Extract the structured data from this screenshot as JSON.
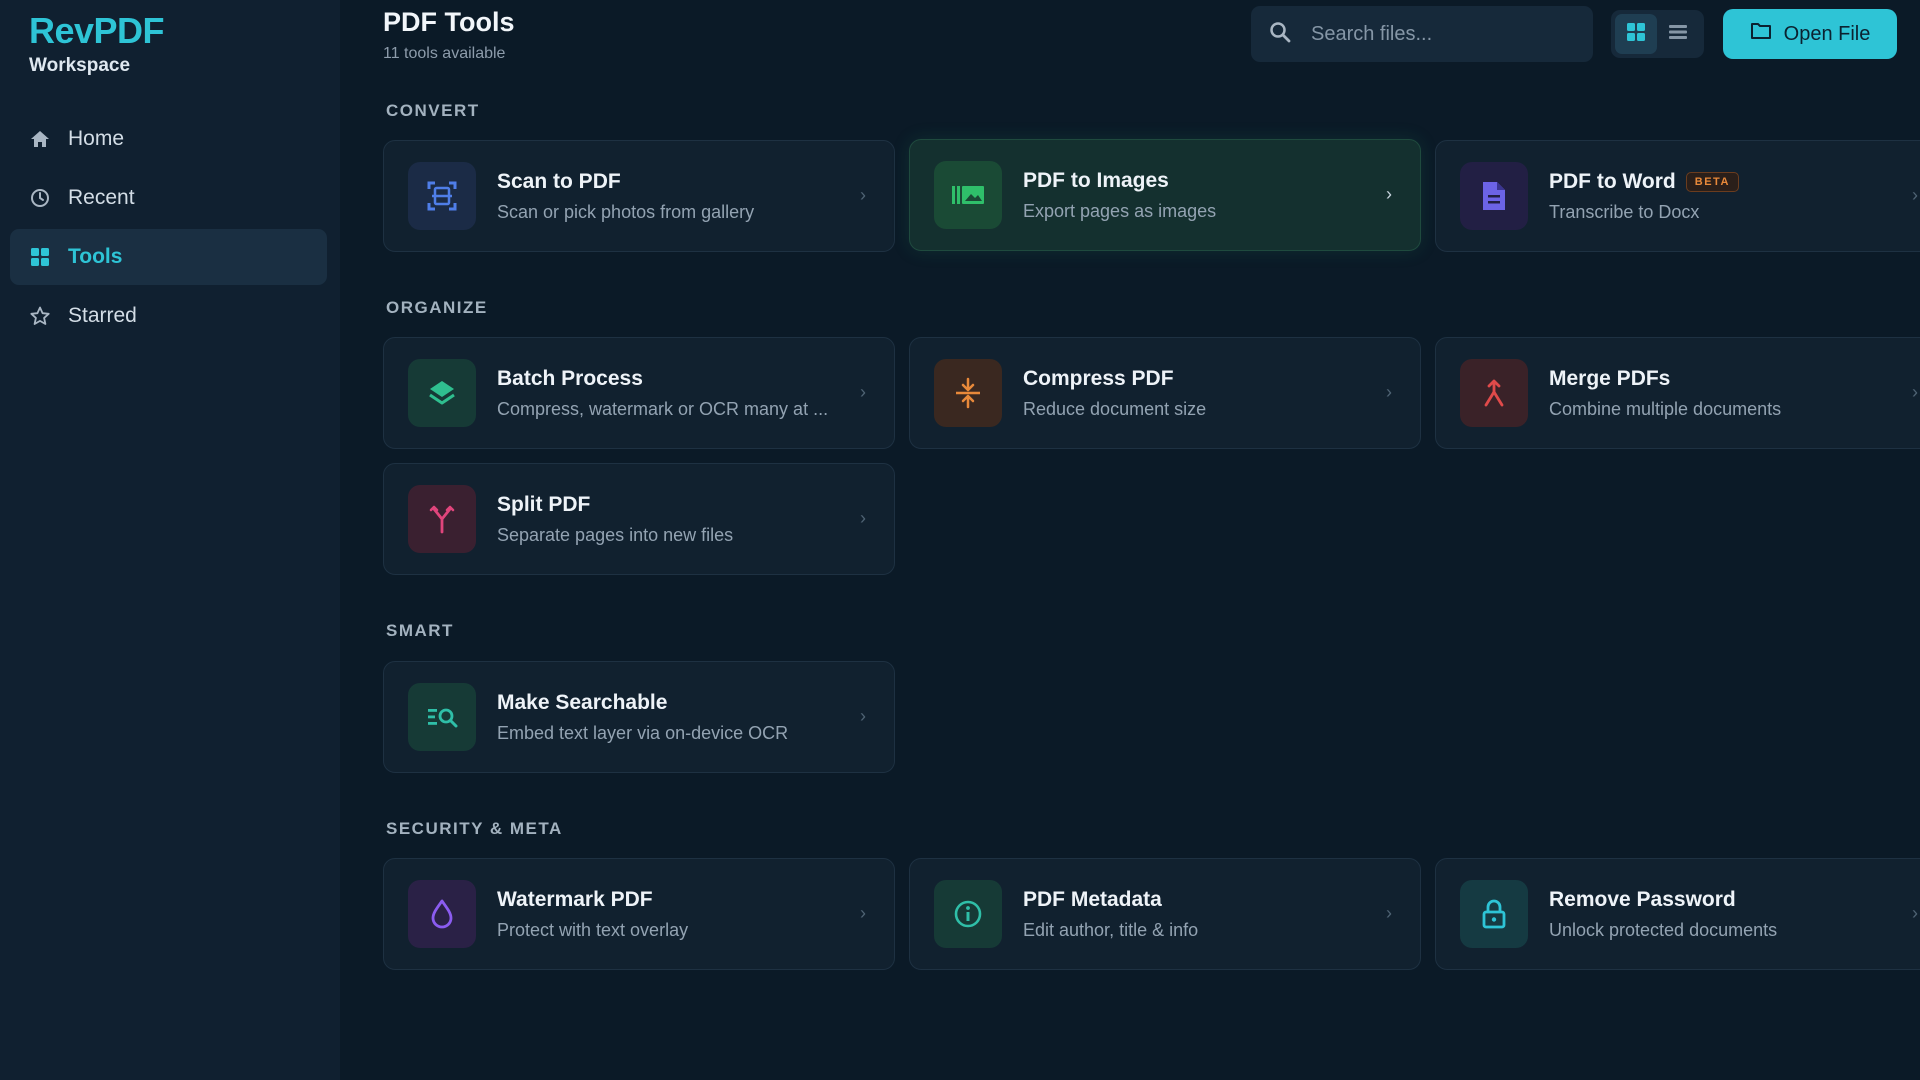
{
  "sidebar": {
    "brand_title": "RevPDF",
    "brand_sub": "Workspace",
    "items": [
      {
        "label": "Home",
        "icon": "home-icon"
      },
      {
        "label": "Recent",
        "icon": "clock-icon"
      },
      {
        "label": "Tools",
        "icon": "grid-icon",
        "active": true
      },
      {
        "label": "Starred",
        "icon": "star-icon"
      }
    ]
  },
  "header": {
    "title": "PDF Tools",
    "subtitle": "11 tools available",
    "search_placeholder": "Search files...",
    "open_label": "Open File",
    "view_modes": [
      "grid",
      "list"
    ],
    "active_view": "grid"
  },
  "sections": [
    {
      "label": "CONVERT",
      "tools": [
        {
          "title": "Scan to PDF",
          "desc": "Scan or pick photos from gallery",
          "icon": "scan-icon",
          "color": "#4f7ee8"
        },
        {
          "title": "PDF to Images",
          "desc": "Export pages as images",
          "icon": "images-icon",
          "color": "#2fbf6a",
          "highlight": true
        },
        {
          "title": "PDF to Word",
          "desc": "Transcribe to Docx",
          "icon": "document-icon",
          "color": "#6c63e6",
          "badge": "BETA"
        }
      ]
    },
    {
      "label": "ORGANIZE",
      "tools": [
        {
          "title": "Batch Process",
          "desc": "Compress, watermark or OCR many at ...",
          "icon": "layers-icon",
          "color": "#2fbf8f"
        },
        {
          "title": "Compress PDF",
          "desc": "Reduce document size",
          "icon": "compress-icon",
          "color": "#e8893a"
        },
        {
          "title": "Merge PDFs",
          "desc": "Combine multiple documents",
          "icon": "merge-icon",
          "color": "#e04a4a"
        },
        {
          "title": "Split PDF",
          "desc": "Separate pages into new files",
          "icon": "split-icon",
          "color": "#e0457c"
        }
      ]
    },
    {
      "label": "SMART",
      "tools": [
        {
          "title": "Make Searchable",
          "desc": "Embed text layer via on-device OCR",
          "icon": "ocr-search-icon",
          "color": "#2fbfa8"
        }
      ]
    },
    {
      "label": "SECURITY & META",
      "tools": [
        {
          "title": "Watermark PDF",
          "desc": "Protect with text overlay",
          "icon": "droplet-icon",
          "color": "#8b5cf0"
        },
        {
          "title": "PDF Metadata",
          "desc": "Edit author, title & info",
          "icon": "info-icon",
          "color": "#2fbfa8"
        },
        {
          "title": "Remove Password",
          "desc": "Unlock protected documents",
          "icon": "unlock-icon",
          "color": "#2ec4d6"
        }
      ]
    }
  ]
}
